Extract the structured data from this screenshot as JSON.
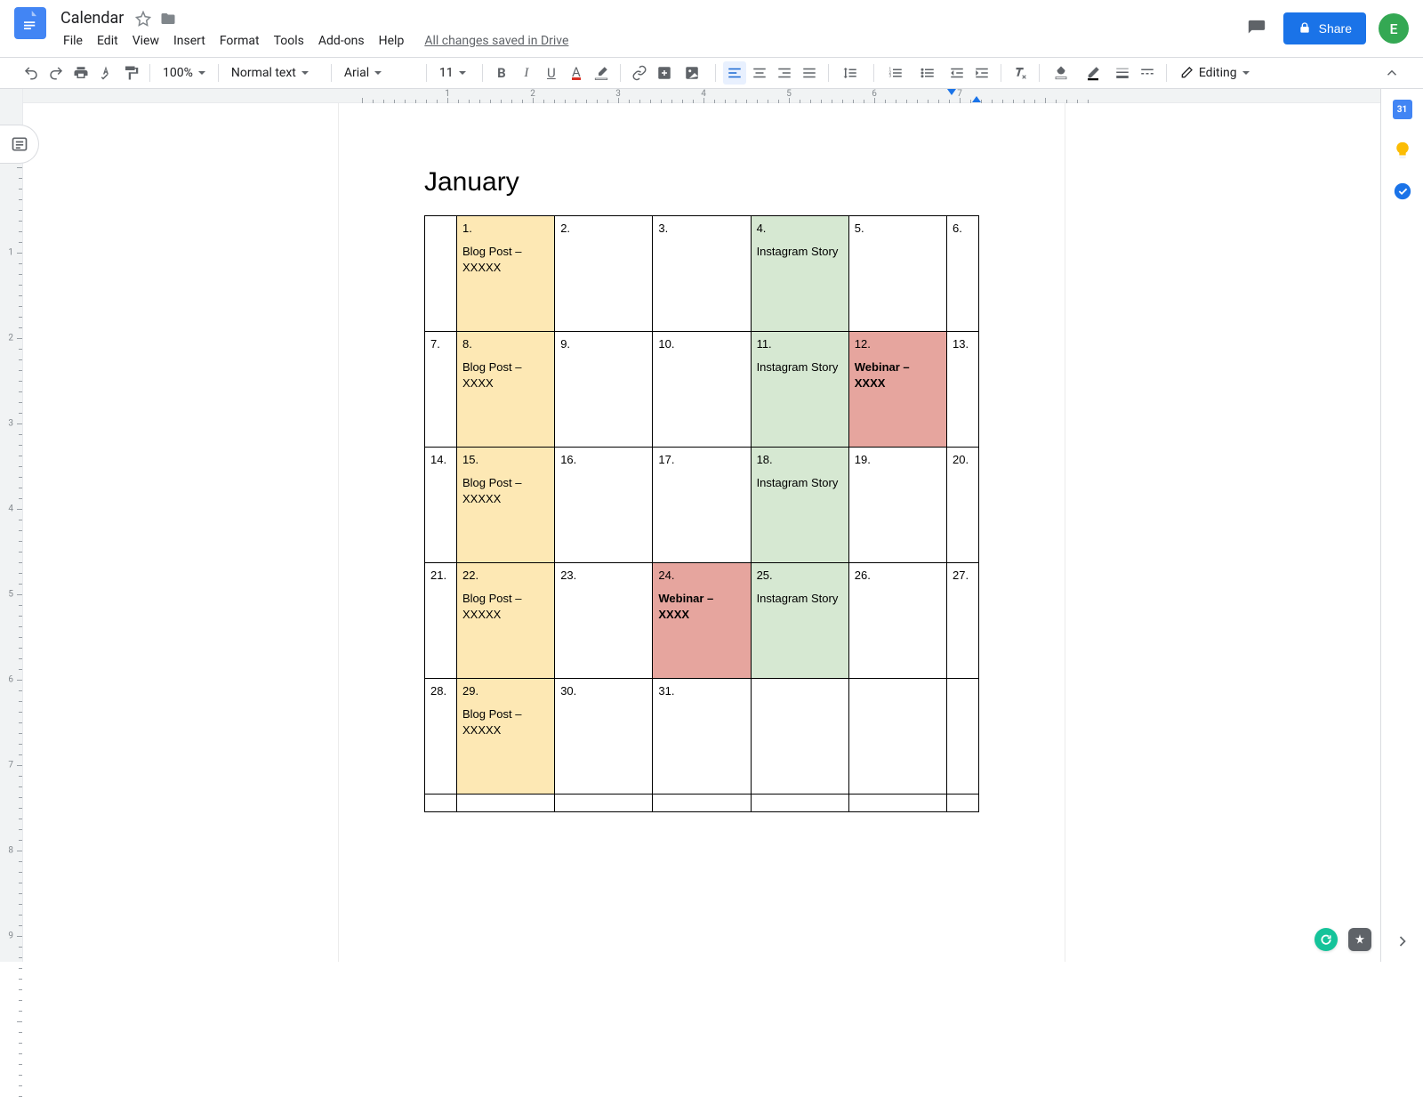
{
  "app": {
    "title": "Calendar",
    "save_status": "All changes saved in Drive",
    "avatar_initial": "E"
  },
  "menubar": [
    "File",
    "Edit",
    "View",
    "Insert",
    "Format",
    "Tools",
    "Add-ons",
    "Help"
  ],
  "toolbar": {
    "zoom": "100%",
    "style": "Normal text",
    "font": "Arial",
    "size": "11",
    "mode": "Editing"
  },
  "share": {
    "label": "Share"
  },
  "ruler": {
    "h_labels": [
      "1",
      "2",
      "3",
      "4",
      "5",
      "6",
      "7"
    ],
    "v_labels": [
      "1",
      "2",
      "3",
      "4",
      "5",
      "6",
      "7",
      "8",
      "9"
    ]
  },
  "doc": {
    "heading": "January",
    "rows": [
      [
        {
          "num": "",
          "body": "",
          "bg": ""
        },
        {
          "num": "1.",
          "body": "Blog Post  – XXXXX",
          "bg": "yellow"
        },
        {
          "num": "2.",
          "body": "",
          "bg": ""
        },
        {
          "num": "3.",
          "body": "",
          "bg": ""
        },
        {
          "num": "4.",
          "body": "Instagram Story",
          "bg": "green"
        },
        {
          "num": "5.",
          "body": "",
          "bg": ""
        },
        {
          "num": "6.",
          "body": "",
          "bg": ""
        }
      ],
      [
        {
          "num": "7.",
          "body": "",
          "bg": ""
        },
        {
          "num": "8.",
          "body": "Blog Post – XXXX",
          "bg": "yellow"
        },
        {
          "num": "9.",
          "body": "",
          "bg": ""
        },
        {
          "num": "10.",
          "body": "",
          "bg": ""
        },
        {
          "num": "11.",
          "body": "Instagram Story",
          "bg": "green"
        },
        {
          "num": "12.",
          "body": "Webinar – XXXX",
          "bg": "red",
          "bold": true
        },
        {
          "num": "13.",
          "body": "",
          "bg": ""
        }
      ],
      [
        {
          "num": "14.",
          "body": "",
          "bg": ""
        },
        {
          "num": "15.",
          "body": "Blog Post  – XXXXX",
          "bg": "yellow"
        },
        {
          "num": "16.",
          "body": "",
          "bg": ""
        },
        {
          "num": "17.",
          "body": "",
          "bg": ""
        },
        {
          "num": "18.",
          "body": "Instagram Story",
          "bg": "green"
        },
        {
          "num": "19.",
          "body": "",
          "bg": ""
        },
        {
          "num": "20.",
          "body": "",
          "bg": ""
        }
      ],
      [
        {
          "num": "21.",
          "body": "",
          "bg": ""
        },
        {
          "num": "22.",
          "body": "Blog Post  – XXXXX",
          "bg": "yellow"
        },
        {
          "num": "23.",
          "body": "",
          "bg": ""
        },
        {
          "num": "24.",
          "body": "Webinar – XXXX",
          "bg": "red",
          "bold": true
        },
        {
          "num": "25.",
          "body": "Instagram Story",
          "bg": "green"
        },
        {
          "num": "26.",
          "body": "",
          "bg": ""
        },
        {
          "num": "27.",
          "body": "",
          "bg": ""
        }
      ],
      [
        {
          "num": "28.",
          "body": "",
          "bg": ""
        },
        {
          "num": "29.",
          "body": "Blog Post  – XXXXX",
          "bg": "yellow"
        },
        {
          "num": "30.",
          "body": "",
          "bg": ""
        },
        {
          "num": "31.",
          "body": "",
          "bg": ""
        },
        {
          "num": "",
          "body": "",
          "bg": ""
        },
        {
          "num": "",
          "body": "",
          "bg": ""
        },
        {
          "num": "",
          "body": "",
          "bg": ""
        }
      ]
    ]
  },
  "colors": {
    "yellow": "#fde8b4",
    "green": "#d6e8d2",
    "red": "#e6a59e",
    "blue": "#1a73e8"
  }
}
